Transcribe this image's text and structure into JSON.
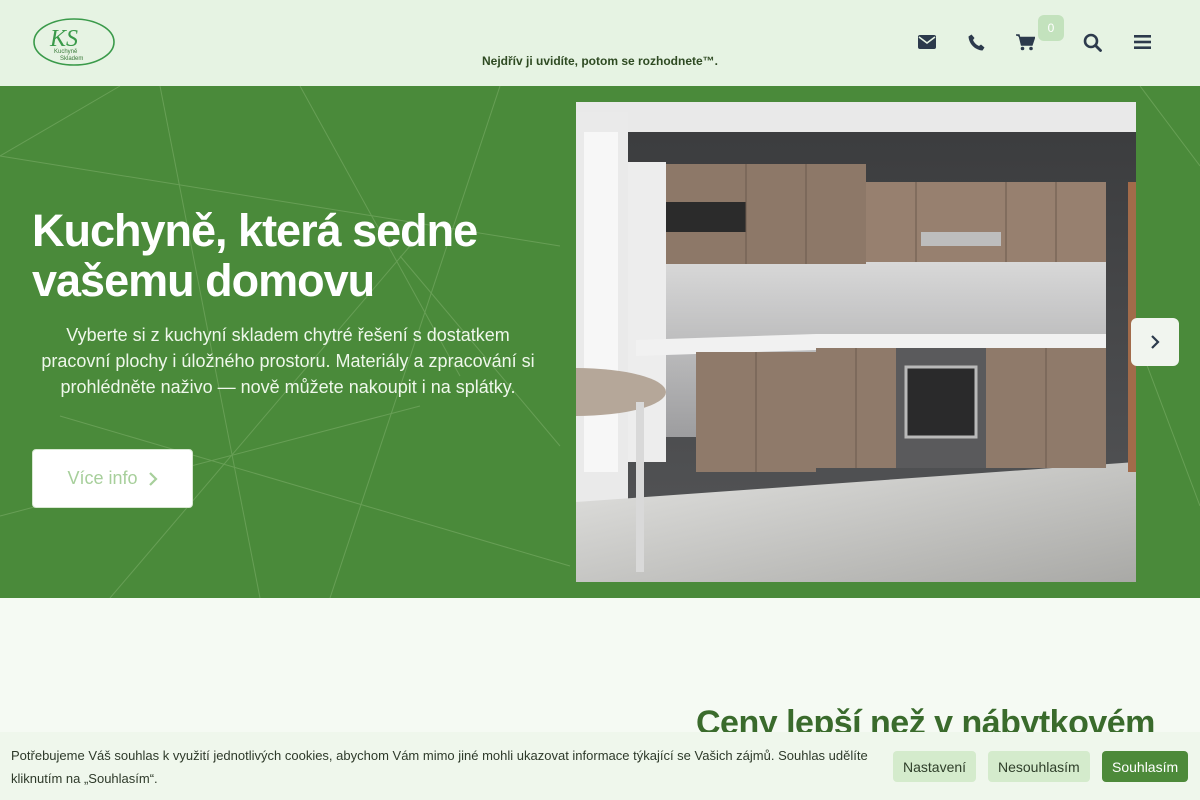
{
  "header": {
    "logo_letters": "KS",
    "logo_line1": "Kuchyně",
    "logo_line2": "Skladem",
    "tagline": "Nejdřív ji uvidíte, potom se rozhodnete™.",
    "cart_count": "0",
    "icons": [
      "envelope-icon",
      "phone-icon",
      "cart-icon",
      "search-icon",
      "menu-icon"
    ]
  },
  "hero": {
    "title": "Kuchyně, která sedne vašemu domovu",
    "text": "Vyberte si z kuchyní skladem chytré řešení s dostatkem pracovní plochy i úložného prostoru. Materiály a zpracování si prohlédněte naživo — nově můžete nakoupit i na splátky.",
    "button_label": "Více info"
  },
  "section": {
    "heading": "Ceny lepší než v nábytkovém"
  },
  "cookie": {
    "text": "Potřebujeme Váš souhlas k využití jednotlivých cookies, abychom Vám mimo jiné mohli ukazovat informace týkající se Vašich zájmů. Souhlas udělíte kliknutím na „Souhlasím“.",
    "settings_label": "Nastavení",
    "decline_label": "Nesouhlasím",
    "accept_label": "Souhlasím"
  },
  "colors": {
    "header_bg": "#e6f3e3",
    "hero_bg": "#4a8a3a",
    "accent": "#4d8a3a"
  }
}
